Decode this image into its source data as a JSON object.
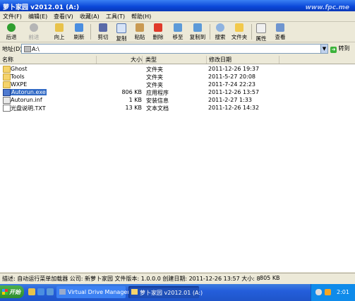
{
  "window": {
    "title": "萝卜家园 v2012.01 (A:)",
    "watermark": "www.fpc.me"
  },
  "menu": [
    "文件(F)",
    "编辑(E)",
    "查看(V)",
    "收藏(A)",
    "工具(T)",
    "帮助(H)"
  ],
  "toolbar": {
    "back": "后退",
    "forward": "前进",
    "up": "向上",
    "refresh": "刷新",
    "cut": "剪切",
    "copy": "复制",
    "paste": "粘贴",
    "delete": "删除",
    "move_to": "移至",
    "copy_to": "复制到",
    "search": "搜索",
    "folders": "文件夹",
    "properties": "属性",
    "views": "查看"
  },
  "address": {
    "label": "地址(D)",
    "value": "A:\\",
    "go": "转到"
  },
  "columns": {
    "name": "名称",
    "size": "大小",
    "type": "类型",
    "modified": "修改日期"
  },
  "files": [
    {
      "name": "Ghost",
      "size": "",
      "type": "文件夹",
      "modified": "2011-12-26 19:37",
      "icon": "folder-icon"
    },
    {
      "name": "Tools",
      "size": "",
      "type": "文件夹",
      "modified": "2011-5-27 20:08",
      "icon": "folder-icon"
    },
    {
      "name": "WXPE",
      "size": "",
      "type": "文件夹",
      "modified": "2011-7-24 22:23",
      "icon": "folder-icon"
    },
    {
      "name": "Autorun.exe",
      "size": "806 KB",
      "type": "应用程序",
      "modified": "2011-12-26 13:57",
      "icon": "exe-icon"
    },
    {
      "name": "Autorun.inf",
      "size": "1 KB",
      "type": "安装信息",
      "modified": "2011-2-27 1:33",
      "icon": "inf-icon"
    },
    {
      "name": "光盘说明.TXT",
      "size": "13 KB",
      "type": "文本文档",
      "modified": "2011-12-26 14:32",
      "icon": "txt-icon"
    }
  ],
  "status": {
    "text": "描述: 自动运行菜单加载器 公司: 新萝卜家园 文件版本: 1.0.0.0 创建日期: 2011-12-26 13:57 大小: 8",
    "size": "805 KB"
  },
  "taskbar": {
    "start": "开始",
    "tasks": [
      "Virtual Drive Manager ...",
      "萝卜家园 v2012.01 (A:)"
    ],
    "clock": "2:01"
  }
}
